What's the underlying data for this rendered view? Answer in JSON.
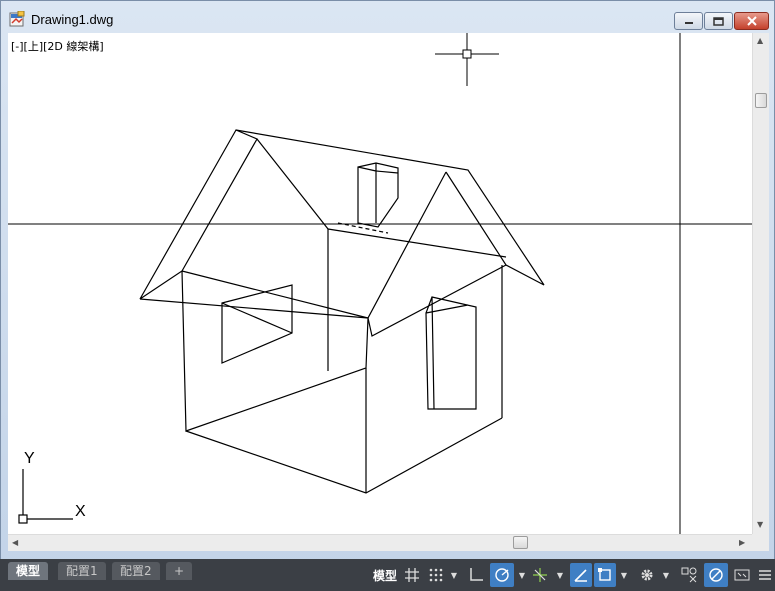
{
  "window": {
    "title": "Drawing1.dwg"
  },
  "viewport": {
    "label": "[-][上][2D 線架構]",
    "ucs": {
      "x_label": "X",
      "y_label": "Y"
    }
  },
  "layout_tabs": [
    {
      "label": "模型",
      "active": true
    },
    {
      "label": "配置1",
      "active": false
    },
    {
      "label": "配置2",
      "active": false
    },
    {
      "label": "+",
      "active": false
    }
  ],
  "statusbar": {
    "model_label": "模型",
    "tools": [
      "grid-icon",
      "snap-icon",
      "ortho-icon",
      "polar-icon",
      "osnap-tracking-icon",
      "lineweight-icon",
      "selection-icon",
      "workspace-gear-icon",
      "annotation-scale-icon",
      "isolate-icon",
      "fullscreen-icon",
      "menu-icon"
    ]
  },
  "colors": {
    "titlebar": "#c2d3e8",
    "statusbar": "#3b3f45",
    "active_toggle": "#3f7fc4",
    "canvas": "#ffffff"
  }
}
